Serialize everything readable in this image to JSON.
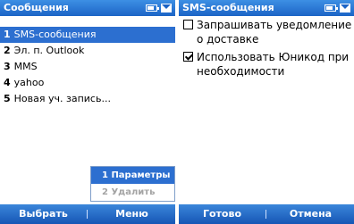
{
  "left_screen": {
    "title": "Сообщения",
    "accounts": [
      {
        "num": "1",
        "label": "SMS-сообщения",
        "selected": true
      },
      {
        "num": "2",
        "label": "Эл. п. Outlook",
        "selected": false
      },
      {
        "num": "3",
        "label": "MMS",
        "selected": false
      },
      {
        "num": "4",
        "label": "yahoo",
        "selected": false
      },
      {
        "num": "5",
        "label": "Новая уч. запись...",
        "selected": false
      }
    ],
    "menu_popup": {
      "items": [
        {
          "label": "1 Параметры",
          "selected": true,
          "disabled": false
        },
        {
          "label": "2 Удалить",
          "selected": false,
          "disabled": true
        }
      ]
    },
    "softkeys": {
      "left": "Выбрать",
      "right": "Меню"
    }
  },
  "right_screen": {
    "title": "SMS-сообщения",
    "options": [
      {
        "label": "Запрашивать уведомление о доставке",
        "checked": false
      },
      {
        "label": "Использовать Юникод при необходимости",
        "checked": true
      }
    ],
    "softkeys": {
      "left": "Готово",
      "right": "Отмена"
    }
  },
  "icons": {
    "battery": "battery-icon",
    "messages": "envelope-icon"
  },
  "colors": {
    "titlebar": "#1c64c6",
    "selection": "#2c6fd0",
    "softbar": "#1656b5"
  }
}
